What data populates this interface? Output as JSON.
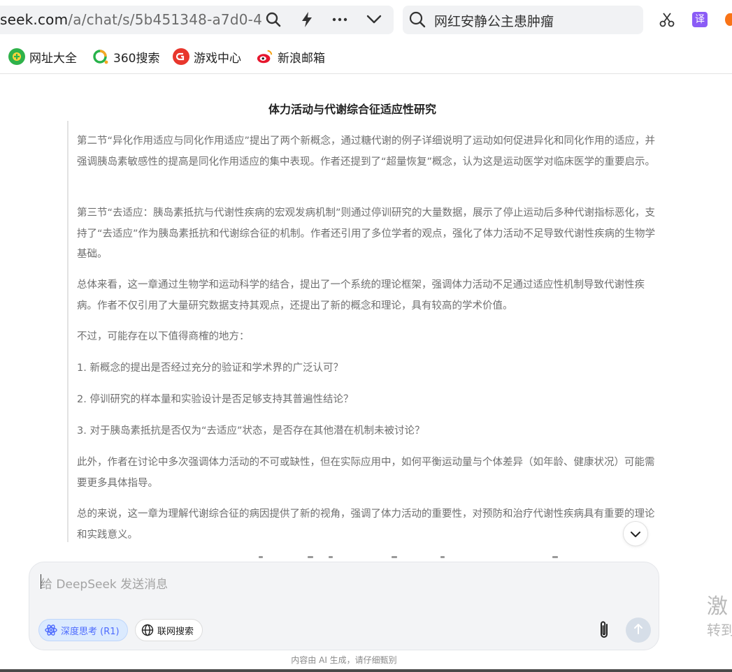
{
  "browser": {
    "url_host": "seek.com",
    "url_path": "/a/chat/s/5b451348-a7d0-4",
    "search_text": "网红安静公主患肿瘤",
    "translate_label": "译"
  },
  "bookmarks": [
    {
      "label": "网址大全",
      "icon": "hao-icon"
    },
    {
      "label": "360搜索",
      "icon": "360-icon"
    },
    {
      "label": "游戏中心",
      "icon": "game-icon"
    },
    {
      "label": "新浪邮箱",
      "icon": "sina-icon"
    }
  ],
  "chat": {
    "title": "体力活动与代谢综合征适应性研究",
    "paragraphs": [
      "第二节“异化作用适应与同化作用适应”提出了两个新概念，通过糖代谢的例子详细说明了运动如何促进异化和同化作用的适应，并强调胰岛素敏感性的提高是同化作用适应的集中表现。作者还提到了“超量恢复”概念，认为这是运动医学对临床医学的重要启示。",
      "第三节“去适应：胰岛素抵抗与代谢性疾病的宏观发病机制”则通过停训研究的大量数据，展示了停止运动后多种代谢指标恶化，支持了“去适应”作为胰岛素抵抗和代谢综合征的机制。作者还引用了多位学者的观点，强化了体力活动不足导致代谢性疾病的生物学基础。",
      "总体来看，这一章通过生物学和运动科学的结合，提出了一个系统的理论框架，强调体力活动不足通过适应性机制导致代谢性疾病。作者不仅引用了大量研究数据支持其观点，还提出了新的概念和理论，具有较高的学术价值。",
      "不过，可能存在以下值得商榷的地方：",
      "1. 新概念的提出是否经过充分的验证和学术界的广泛认可？",
      "2. 停训研究的样本量和实验设计是否足够支持其普遍性结论？",
      "3. 对于胰岛素抵抗是否仅为“去适应”状态，是否存在其他潜在机制未被讨论？",
      "此外，作者在讨论中多次强调体力活动的不可或缺性，但在实际应用中，如何平衡运动量与个体差异（如年龄、健康状况）可能需要更多具体指导。",
      "总的来说，这一章为理解代谢综合征的病因提供了新的视角，强调了体力活动的重要性，对预防和治疗代谢性疾病具有重要的理论和实践意义。"
    ]
  },
  "composer": {
    "placeholder": "给 DeepSeek 发送消息",
    "deep_think_label": "深度思考 (R1)",
    "web_search_label": "联网搜索"
  },
  "disclaimer": "内容由 AI 生成，请仔细甄别",
  "side_banner": {
    "line1": "激",
    "line2": "转到"
  },
  "colors": {
    "accent": "#4d6bfe",
    "body_text": "#6f6f6f",
    "title_text": "#222222"
  }
}
